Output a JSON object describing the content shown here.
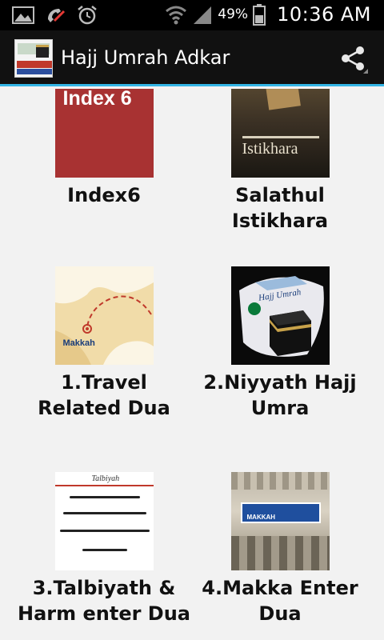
{
  "status_bar": {
    "battery_percent": "49%",
    "time": "10:36 AM"
  },
  "action_bar": {
    "title": "Hajj Umrah Adkar",
    "share_icon": "share-icon",
    "app_icon_text": [
      "HAJJ & UMRA",
      "ADKAR"
    ]
  },
  "tiles": [
    {
      "label": "Index6",
      "thumb_text": "Index 6"
    },
    {
      "label": "Salathul Istikhara",
      "thumb_text": "Istikhara"
    },
    {
      "label": "1.Travel Related Dua",
      "thumb_text": "Makkah"
    },
    {
      "label": "2.Niyyath Hajj Umra",
      "thumb_text": "Hajj Umrah"
    },
    {
      "label": "3.Talbiyath & Harm enter Dua",
      "thumb_text": "Talbiyah"
    },
    {
      "label": "4.Makka Enter Dua",
      "thumb_text": "MAKKAH"
    }
  ],
  "colors": {
    "accent": "#33b5e5",
    "actionbar_bg": "#111111",
    "content_bg": "#f2f2f2"
  }
}
